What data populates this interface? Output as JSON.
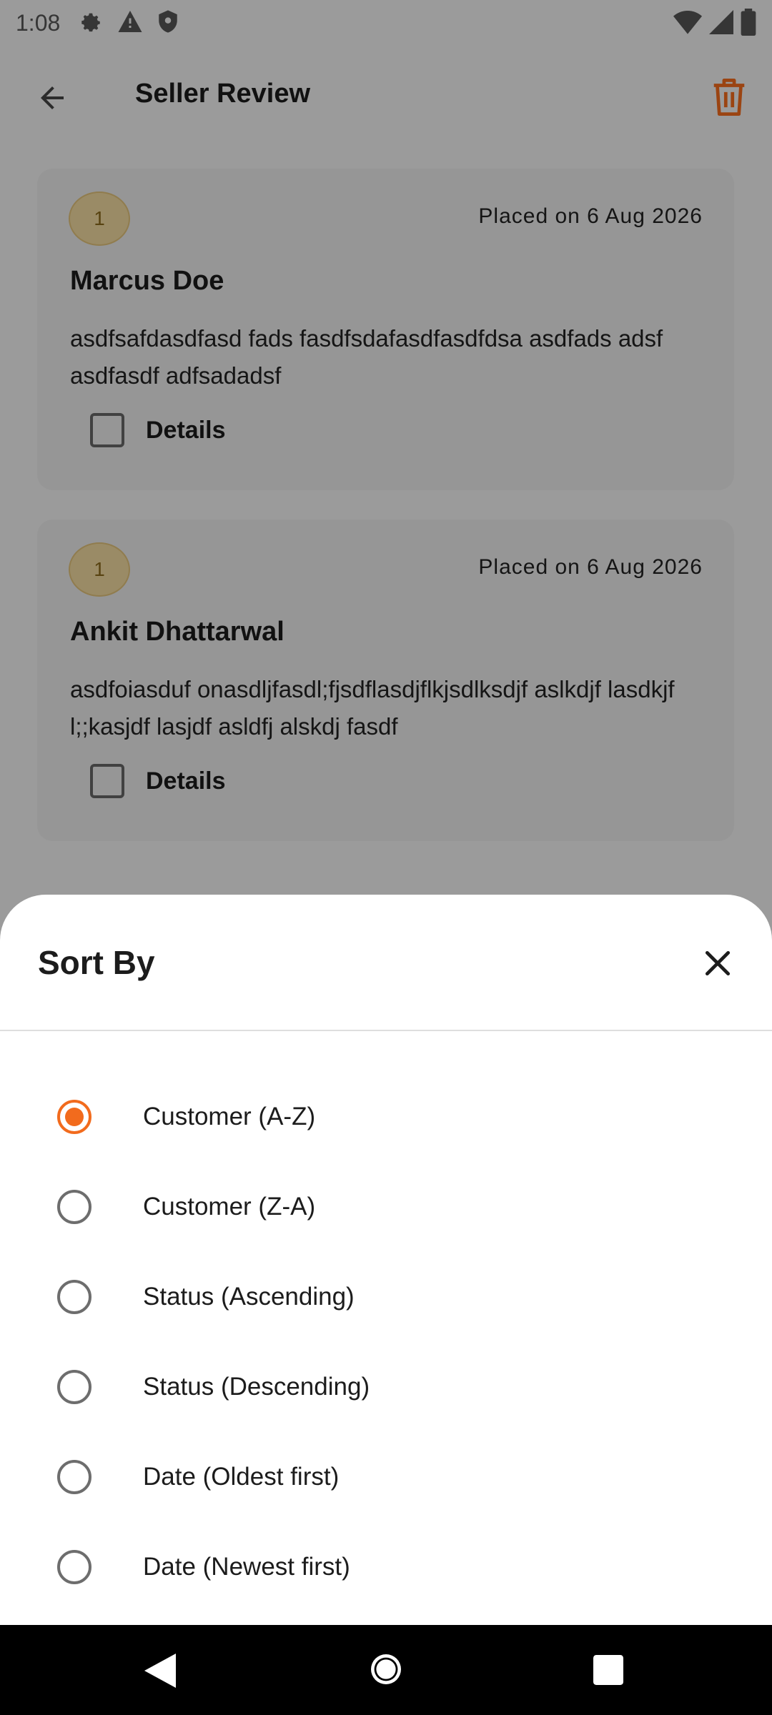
{
  "status_bar": {
    "time": "1:08"
  },
  "app_bar": {
    "title": "Seller Review"
  },
  "reviews": [
    {
      "badge": "1",
      "placed": "Placed on 6 Aug 2026",
      "customer": "Marcus Doe",
      "text": "asdfsafdasdfasd fads fasdfsdafasdfasdfdsa asdfads adsf asdfasdf adfsadadsf",
      "details_label": "Details"
    },
    {
      "badge": "1",
      "placed": "Placed on 6 Aug 2026",
      "customer": "Ankit Dhattarwal",
      "text": "asdfoiasduf onasdljfasdl;fjsdflasdjflkjsdlksdjf aslkdjf lasdkjf l;;kasjdf lasjdf asldfj alskdj fasdf",
      "details_label": "Details"
    }
  ],
  "sort_sheet": {
    "title": "Sort By",
    "options": [
      {
        "label": "Customer (A-Z)",
        "selected": true
      },
      {
        "label": "Customer (Z-A)",
        "selected": false
      },
      {
        "label": "Status (Ascending)",
        "selected": false
      },
      {
        "label": "Status (Descending)",
        "selected": false
      },
      {
        "label": "Date (Oldest first)",
        "selected": false
      },
      {
        "label": "Date (Newest first)",
        "selected": false
      }
    ]
  },
  "colors": {
    "accent": "#f26b1d",
    "badge_bg": "#f1d9a0"
  },
  "icons": {
    "back": "arrow-left-icon",
    "trash": "trash-icon",
    "close": "close-icon",
    "settings": "gear-icon",
    "warning": "warning-icon",
    "shield": "shield-icon",
    "wifi": "wifi-icon",
    "signal": "signal-icon",
    "battery": "battery-icon"
  }
}
